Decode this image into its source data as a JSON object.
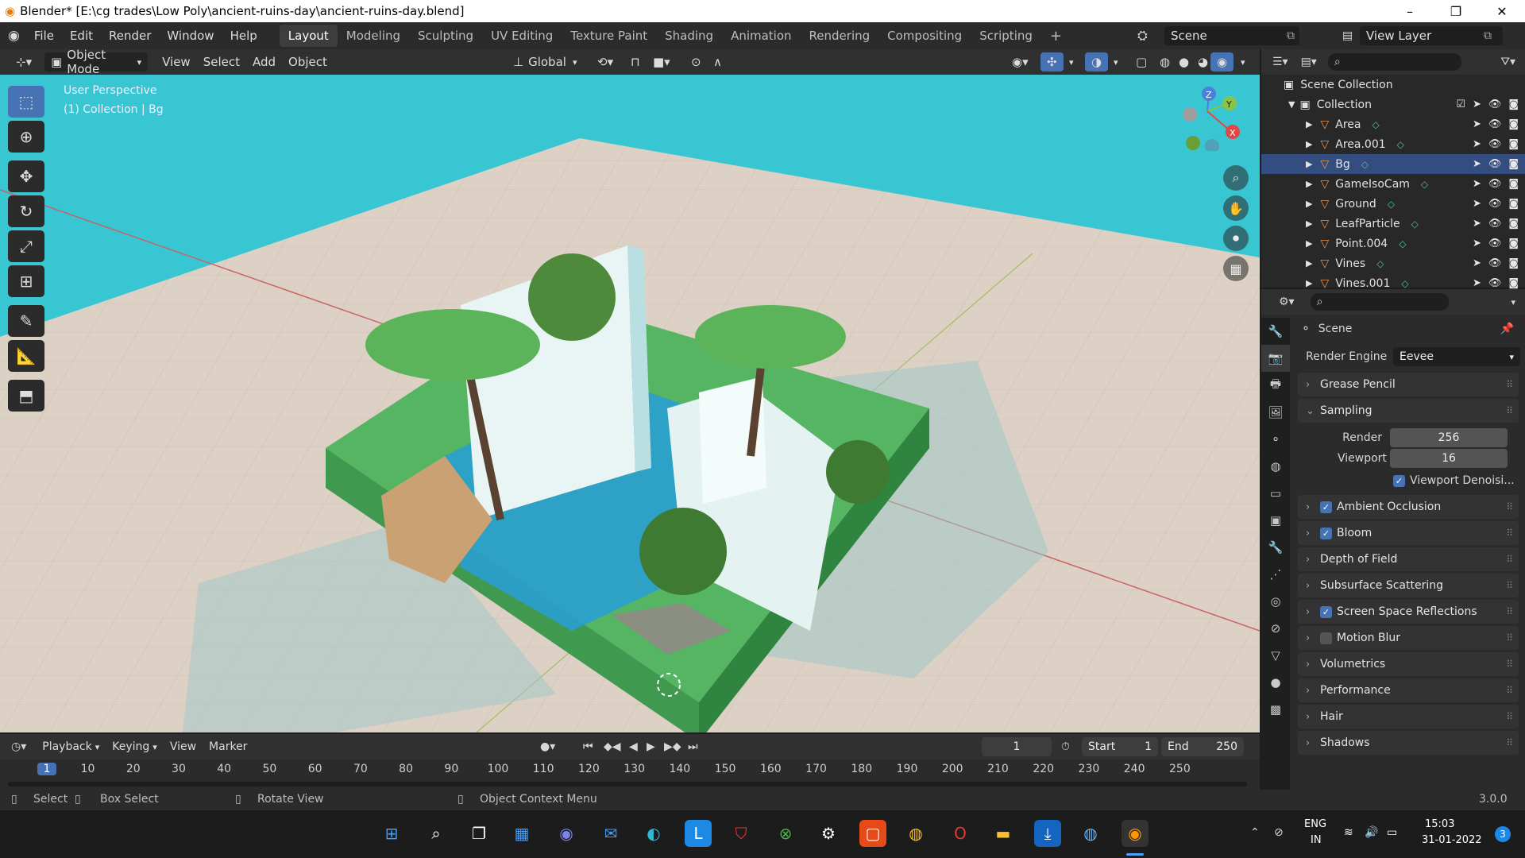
{
  "window": {
    "title": "Blender* [E:\\cg trades\\Low Poly\\ancient-ruins-day\\ancient-ruins-day.blend]",
    "controls": [
      "–",
      "❐",
      "✕"
    ]
  },
  "menu": [
    "File",
    "Edit",
    "Render",
    "Window",
    "Help"
  ],
  "workspaces": [
    {
      "label": "Layout",
      "active": true
    },
    {
      "label": "Modeling"
    },
    {
      "label": "Sculpting"
    },
    {
      "label": "UV Editing"
    },
    {
      "label": "Texture Paint"
    },
    {
      "label": "Shading"
    },
    {
      "label": "Animation"
    },
    {
      "label": "Rendering"
    },
    {
      "label": "Compositing"
    },
    {
      "label": "Scripting"
    }
  ],
  "add_workspace": "+",
  "scene_name": "Scene",
  "view_layer": "View Layer",
  "viewport_header": {
    "mode": "Object Mode",
    "menus": [
      "View",
      "Select",
      "Add",
      "Object"
    ],
    "orientation": "Global"
  },
  "viewport": {
    "perspective": "User Perspective",
    "collection_info": "(1) Collection | Bg",
    "colors": {
      "sky": "#39c6d3",
      "ground": "#ddd0c4",
      "grass": "#5bb86b"
    }
  },
  "outliner": {
    "root": "Scene Collection",
    "collection": "Collection",
    "items": [
      {
        "name": "Area",
        "icon": "light-icon"
      },
      {
        "name": "Area.001",
        "icon": "light-icon"
      },
      {
        "name": "Bg",
        "icon": "mesh-icon",
        "selected": true
      },
      {
        "name": "GameIsoCam",
        "icon": "camera-icon"
      },
      {
        "name": "Ground",
        "icon": "mesh-icon"
      },
      {
        "name": "LeafParticle",
        "icon": "mesh-icon"
      },
      {
        "name": "Point.004",
        "icon": "light-icon"
      },
      {
        "name": "Vines",
        "icon": "mesh-icon"
      },
      {
        "name": "Vines.001",
        "icon": "mesh-icon"
      }
    ]
  },
  "properties": {
    "context": "Scene",
    "render_engine_label": "Render Engine",
    "render_engine": "Eevee",
    "sampling": {
      "label": "Sampling",
      "render_label": "Render",
      "render": "256",
      "viewport_label": "Viewport",
      "viewport": "16",
      "denoise": "Viewport Denoisi..."
    },
    "panels": [
      {
        "label": "Grease Pencil",
        "checkbox": null
      },
      {
        "label": "Ambient Occlusion",
        "checkbox": true
      },
      {
        "label": "Bloom",
        "checkbox": true
      },
      {
        "label": "Depth of Field",
        "checkbox": null
      },
      {
        "label": "Subsurface Scattering",
        "checkbox": null
      },
      {
        "label": "Screen Space Reflections",
        "checkbox": true
      },
      {
        "label": "Motion Blur",
        "checkbox": false
      },
      {
        "label": "Volumetrics",
        "checkbox": null
      },
      {
        "label": "Performance",
        "checkbox": null
      },
      {
        "label": "Hair",
        "checkbox": null
      },
      {
        "label": "Shadows",
        "checkbox": null
      }
    ]
  },
  "timeline": {
    "menus": [
      "Playback",
      "Keying",
      "View",
      "Marker"
    ],
    "current_frame": "1",
    "start_label": "Start",
    "start": "1",
    "end_label": "End",
    "end": "250",
    "ticks": [
      "1",
      "10",
      "20",
      "30",
      "40",
      "50",
      "60",
      "70",
      "80",
      "90",
      "100",
      "110",
      "120",
      "130",
      "140",
      "150",
      "160",
      "170",
      "180",
      "190",
      "200",
      "210",
      "220",
      "230",
      "240",
      "250"
    ]
  },
  "statusbar": {
    "select": "Select",
    "box_select": "Box Select",
    "rotate": "Rotate View",
    "context_menu": "Object Context Menu",
    "version": "3.0.0"
  },
  "taskbar": {
    "lang": "ENG",
    "region": "IN",
    "time": "15:03",
    "date": "31-01-2022",
    "notifications": "3"
  }
}
